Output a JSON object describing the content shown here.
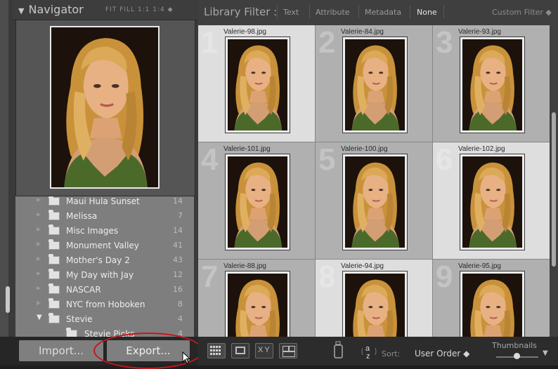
{
  "navigator": {
    "title": "Navigator",
    "options": "FIT  FILL  1:1  1:4 ◆"
  },
  "folders": [
    {
      "name": "Maui Hula Sunset",
      "count": "14",
      "expanded": false
    },
    {
      "name": "Melissa",
      "count": "7",
      "expanded": false
    },
    {
      "name": "Misc Images",
      "count": "14",
      "expanded": false
    },
    {
      "name": "Monument Valley",
      "count": "41",
      "expanded": false
    },
    {
      "name": "Mother's Day 2",
      "count": "43",
      "expanded": false
    },
    {
      "name": "My Day with Jay",
      "count": "12",
      "expanded": false
    },
    {
      "name": "NASCAR",
      "count": "16",
      "expanded": false
    },
    {
      "name": "NYC from Hoboken",
      "count": "8",
      "expanded": false
    },
    {
      "name": "Stevie",
      "count": "4",
      "expanded": true
    },
    {
      "name": "Stevie Picks",
      "count": "4",
      "expanded": false
    }
  ],
  "buttons": {
    "import": "Import...",
    "export": "Export..."
  },
  "filter": {
    "title": "Library Filter :",
    "text": "Text",
    "attribute": "Attribute",
    "metadata": "Metadata",
    "none": "None",
    "custom": "Custom Filter ◆"
  },
  "grid": [
    {
      "index": "1",
      "file": "Valerie-98.jpg",
      "selected": true
    },
    {
      "index": "2",
      "file": "Valerie-84.jpg",
      "selected": false
    },
    {
      "index": "3",
      "file": "Valerie-93.jpg",
      "selected": false
    },
    {
      "index": "4",
      "file": "Valerie-101.jpg",
      "selected": false
    },
    {
      "index": "5",
      "file": "Valerie-100.jpg",
      "selected": false
    },
    {
      "index": "6",
      "file": "Valerie-102.jpg",
      "selected": true
    },
    {
      "index": "7",
      "file": "Valerie-88.jpg",
      "selected": false
    },
    {
      "index": "8",
      "file": "Valerie-94.jpg",
      "selected": true
    },
    {
      "index": "9",
      "file": "Valerie-95.jpg",
      "selected": false
    }
  ],
  "toolbar": {
    "sort_label": "Sort:",
    "sort_value": "User Order ◆",
    "thumbnails_label": "Thumbnails",
    "thumbnails_dropdown": "▼"
  }
}
